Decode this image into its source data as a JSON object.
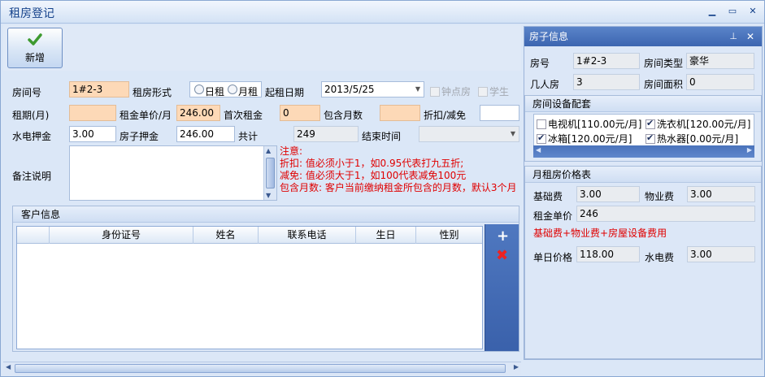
{
  "window": {
    "title": "租房登记"
  },
  "toolbar": {
    "add_label": "新增"
  },
  "form": {
    "room_no_label": "房间号",
    "room_no_value": "1#2-3",
    "rent_type_label": "租房形式",
    "rent_daily": "日租",
    "rent_monthly": "月租",
    "start_date_label": "起租日期",
    "start_date_value": "2013/5/25",
    "hourly_room": "钟点房",
    "student": "学生",
    "period_label": "租期(月)",
    "period_value": "",
    "unit_price_label": "租金单价/月",
    "unit_price_value": "246.00",
    "first_rent_label": "首次租金",
    "first_rent_value": "0",
    "months_included_label": "包含月数",
    "months_included_value": "",
    "discount_label": "折扣/减免",
    "discount_value": "",
    "utility_deposit_label": "水电押金",
    "utility_deposit_value": "3.00",
    "room_deposit_label": "房子押金",
    "room_deposit_value": "246.00",
    "total_label": "共计",
    "total_value": "249",
    "end_time_label": "结束时间",
    "end_time_value": "",
    "remark_label": "备注说明",
    "remark_value": ""
  },
  "notes": [
    "注意:",
    "折扣: 值必须小于1，如0.95代表打九五折;",
    "减免: 值必须大于1，如100代表减免100元",
    "包含月数: 客户当前缴纳租金所包含的月数，默认3个月"
  ],
  "customer": {
    "title": "客户信息",
    "columns": [
      "",
      "身份证号",
      "姓名",
      "联系电话",
      "生日",
      "性别"
    ],
    "add_icon": "plus-icon",
    "delete_icon": "x-icon"
  },
  "room_info": {
    "title": "房子信息",
    "room_no_label": "房号",
    "room_no_value": "1#2-3",
    "room_type_label": "房间类型",
    "room_type_value": "豪华",
    "room_count_label": "几人房",
    "room_count_value": "3",
    "area_label": "房间面积",
    "area_value": "0",
    "equipment": {
      "title": "房间设备配套",
      "items": [
        {
          "label": "电视机[110.00元/月]",
          "checked": false
        },
        {
          "label": "洗衣机[120.00元/月]",
          "checked": true
        },
        {
          "label": "冰箱[120.00元/月]",
          "checked": true
        },
        {
          "label": "热水器[0.00元/月]",
          "checked": true
        }
      ]
    },
    "pricing": {
      "title": "月租房价格表",
      "base_fee_label": "基础费",
      "base_fee_value": "3.00",
      "property_fee_label": "物业费",
      "property_fee_value": "3.00",
      "unit_price_label": "租金单价",
      "unit_price_value": "246",
      "formula": "基础费+物业费+房屋设备费用",
      "daily_price_label": "单日价格",
      "daily_price_value": "118.00",
      "utility_fee_label": "水电费",
      "utility_fee_value": "3.00"
    }
  },
  "colors": {
    "accent": "#3c65b0",
    "warning_text": "#e00000",
    "input_highlight": "#fdd9b7"
  }
}
